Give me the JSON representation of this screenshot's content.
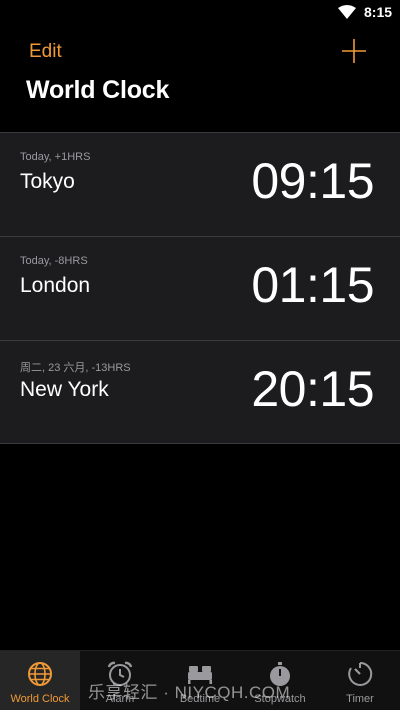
{
  "status_bar": {
    "time": "8:15",
    "icons": [
      "wifi-icon"
    ]
  },
  "header": {
    "edit_label": "Edit",
    "add_icon": "plus-icon",
    "title": "World Clock"
  },
  "clocks": [
    {
      "offset": "Today, +1HRS",
      "city": "Tokyo",
      "time": "09:15"
    },
    {
      "offset": "Today, -8HRS",
      "city": "London",
      "time": "01:15"
    },
    {
      "offset": "周二, 23 六月, -13HRS",
      "city": "New York",
      "time": "20:15"
    }
  ],
  "tab_bar": {
    "tabs": [
      {
        "label": "World Clock",
        "icon": "globe-icon",
        "active": true
      },
      {
        "label": "Alarm",
        "icon": "alarm-icon",
        "active": false
      },
      {
        "label": "Bedtime",
        "icon": "bed-icon",
        "active": false
      },
      {
        "label": "Stopwatch",
        "icon": "stopwatch-icon",
        "active": false
      },
      {
        "label": "Timer",
        "icon": "timer-icon",
        "active": false
      }
    ]
  },
  "watermark": "乐享轻汇 · NIYCQH.COM",
  "colors": {
    "accent": "#f09a37",
    "background": "#000000",
    "row_background": "#1c1c1e",
    "secondary_text": "#9a9a9e"
  }
}
